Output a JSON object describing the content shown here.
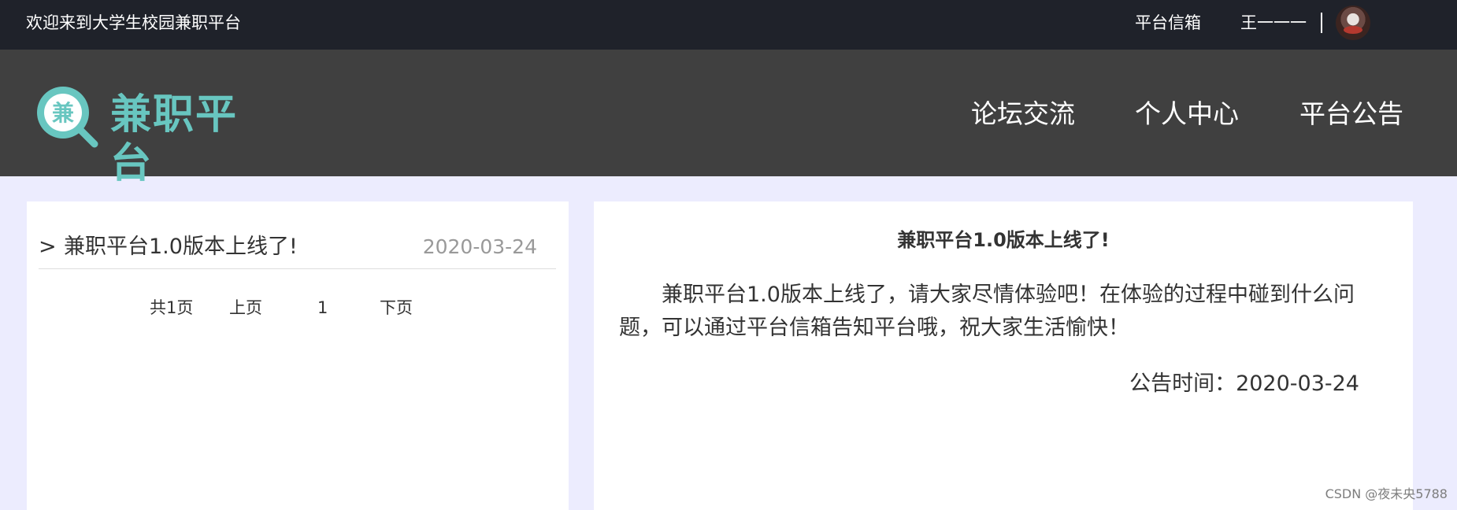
{
  "topbar": {
    "welcome": "欢迎来到大学生校园兼职平台",
    "mailbox": "平台信箱",
    "username": "王一一一"
  },
  "header": {
    "logo_text": "兼职平台",
    "logo_char": "兼",
    "nav": [
      "论坛交流",
      "个人中心",
      "平台公告"
    ]
  },
  "announcement_list": {
    "items": [
      {
        "marker": ">",
        "title": "兼职平台1.0版本上线了!",
        "date": "2020-03-24"
      }
    ],
    "pager": {
      "total": "共1页",
      "prev": "上页",
      "current": "1",
      "next": "下页"
    }
  },
  "announcement_detail": {
    "title": "兼职平台1.0版本上线了!",
    "body": "兼职平台1.0版本上线了，请大家尽情体验吧！在体验的过程中碰到什么问题，可以通过平台信箱告知平台哦，祝大家生活愉快！",
    "time": "公告时间：2020-03-24"
  },
  "watermark": "CSDN @夜未央5788",
  "colors": {
    "topbar_bg": "#1f222a",
    "header_bg": "#404040",
    "page_bg": "#ececfe",
    "logo_accent": "#68c6c0"
  },
  "icons": {
    "logo_mark": "magnifier-logo-icon"
  }
}
